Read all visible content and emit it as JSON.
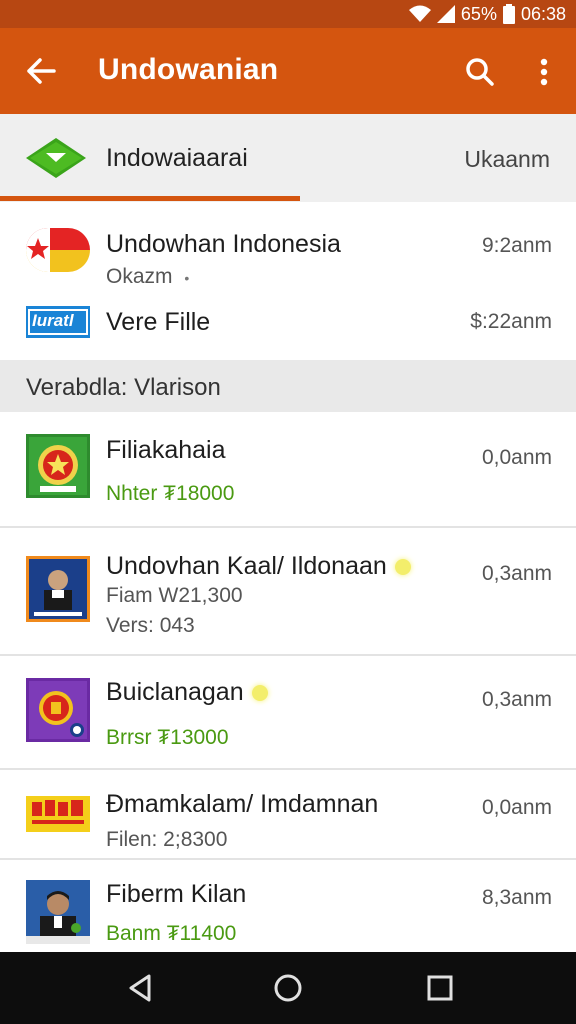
{
  "status_bar": {
    "battery": "65%",
    "time": "06:38"
  },
  "app_bar": {
    "title": "Undowanian",
    "back_icon": "arrow-back-icon",
    "search_icon": "search-icon",
    "more_icon": "more-vert-icon"
  },
  "tab": {
    "label": "Indowaiaarai",
    "right_text": "Ukaanm",
    "icon": "green-diamond-chevron-icon"
  },
  "top_items": [
    {
      "title": "Undowhan Indonesia",
      "sub": "Okazm",
      "meta": "9:2anm"
    },
    {
      "title": "Vere Fille",
      "meta": "$:22anm",
      "logo_text": "Iuratl"
    }
  ],
  "section": {
    "label": "Verabdla: Vlarison"
  },
  "items": [
    {
      "title": "Filiakahaia",
      "sub": "Nhter ₮18000",
      "meta": "0,0anm"
    },
    {
      "title": "Undovhan Kaal/ Ildonaan",
      "sub": "Fiam W21,300",
      "sub2": "Vers: 043",
      "meta": "0,3anm"
    },
    {
      "title": "Buiclanagan",
      "sub": "Brrsr ₮13000",
      "meta": "0,3anm"
    },
    {
      "title": "Ðmamkalam/ Imdamnan",
      "sub": "Filen: 2;8300",
      "meta": "0,0anm"
    },
    {
      "title": "Fiberm Kilan",
      "sub": "Banm ₮11400",
      "meta": "8,3anm"
    }
  ],
  "colors": {
    "status_bar": "#b74712",
    "app_bar": "#d4550f",
    "accent_green": "#4a9a12"
  },
  "nav": {
    "back": "nav-back-icon",
    "home": "nav-home-icon",
    "recents": "nav-recents-icon"
  }
}
